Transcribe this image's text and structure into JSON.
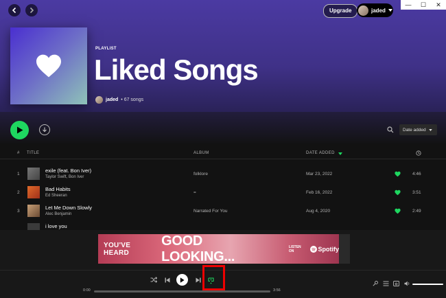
{
  "header": {
    "upgrade_label": "Upgrade",
    "user_name": "jaded"
  },
  "window_controls": {
    "minimize": "—",
    "maximize": "☐",
    "close": "✕"
  },
  "playlist": {
    "type_label": "PLAYLIST",
    "title": "Liked Songs",
    "owner": "jaded",
    "song_count": "• 67 songs"
  },
  "sort": {
    "label": "Date added"
  },
  "table": {
    "columns": {
      "index": "#",
      "title": "TITLE",
      "album": "ALBUM",
      "date_added": "DATE ADDED"
    },
    "rows": [
      {
        "num": "1",
        "title": "exile (feat. Bon Iver)",
        "artist": "Taylor Swift, Bon Iver",
        "album": "folklore",
        "date": "Mar 23, 2022",
        "duration": "4:46"
      },
      {
        "num": "2",
        "title": "Bad Habits",
        "artist": "Ed Sheeran",
        "album": "=",
        "date": "Feb 16, 2022",
        "duration": "3:51"
      },
      {
        "num": "3",
        "title": "Let Me Down Slowly",
        "artist": "Alec Benjamin",
        "album": "Narrated For You",
        "date": "Aug 4, 2020",
        "duration": "2:49"
      },
      {
        "num": "",
        "title": "i love you",
        "artist": "",
        "album": "",
        "date": "",
        "duration": ""
      }
    ]
  },
  "ad": {
    "line1": "YOU'VE HEARD",
    "line2": "GOOD LOOKING...",
    "line3": "LISTEN ON",
    "brand": "Spotify"
  },
  "player": {
    "elapsed": "0:00",
    "total": "3:56",
    "progress": 0
  },
  "colors": {
    "accent": "#1ed760",
    "hero_top": "#4b3aa2",
    "background": "#121212",
    "highlight": "#e00000"
  }
}
